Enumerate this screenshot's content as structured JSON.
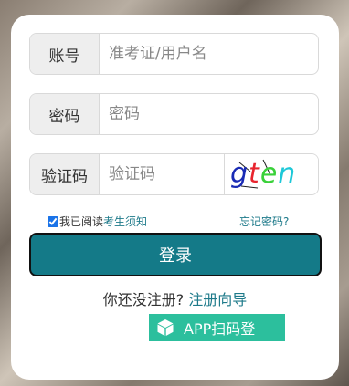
{
  "form": {
    "account": {
      "label": "账号",
      "placeholder": "准考证/用户名"
    },
    "password": {
      "label": "密码",
      "placeholder": "密码"
    },
    "captcha": {
      "label": "验证码",
      "placeholder": "验证码",
      "image_text": "gten"
    }
  },
  "agreement": {
    "prefix": "我已阅读",
    "link": "考生须知",
    "checked": true
  },
  "forgot_link": "忘记密码?",
  "login_button": "登录",
  "register": {
    "prompt": "你还没注册?",
    "link": "注册向导"
  },
  "app_button": {
    "label": "APP扫码登",
    "icon": "cube-icon"
  },
  "colors": {
    "primary": "#147a88",
    "link": "#1e7a8a",
    "app": "#2cbf9d"
  }
}
